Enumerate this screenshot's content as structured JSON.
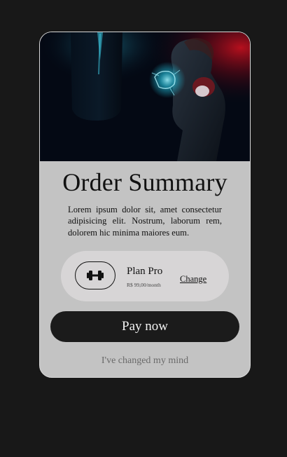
{
  "order": {
    "title": "Order Summary",
    "description": "Lorem ipsum dolor sit, amet consectetur adipisicing elit. Nostrum, laborum rem, dolorem hic minima maiores eum."
  },
  "plan": {
    "icon": "dumbbell-icon",
    "name": "Plan Pro",
    "price": "R$ 99,00/month",
    "change_label": "Change"
  },
  "actions": {
    "pay_label": "Pay now",
    "cancel_label": "I've changed my mind"
  },
  "colors": {
    "page_background": "#181818",
    "card_background": "#c3c3c3",
    "plan_background": "#d7d5d6",
    "button_background": "#1b1b1b",
    "hero_glow_cyan": "#22c8e6",
    "hero_glow_red": "#c0101e"
  }
}
